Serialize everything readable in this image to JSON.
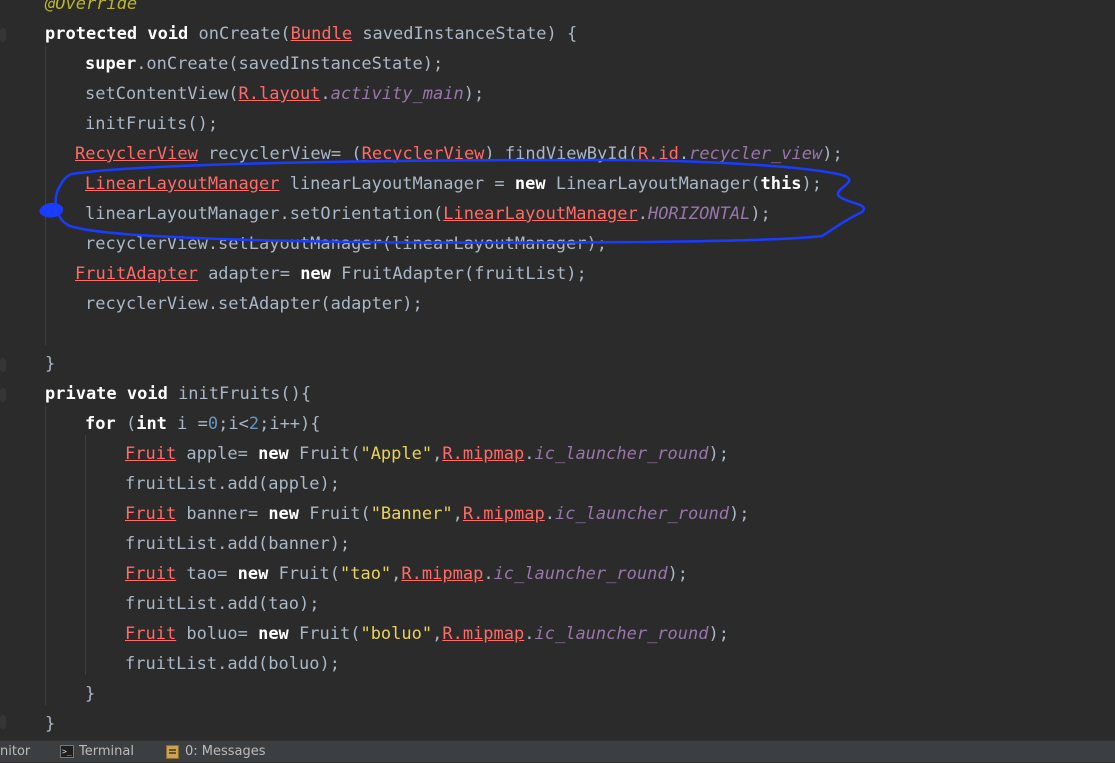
{
  "colors": {
    "background": "#2b2b2b",
    "default": "#a9b7c6",
    "keyword": "#ffffff",
    "annotation": "#bbb529",
    "error": "#ff6b68",
    "field": "#9876aa",
    "string": "#e8d35a",
    "number": "#6897bb",
    "annotation_ink": "#1a3cff"
  },
  "editor": {
    "lines": [
      [
        {
          "t": "@Override",
          "c": "annotation",
          "i": true
        }
      ],
      [
        {
          "t": "protected void ",
          "c": "keyword",
          "b": true
        },
        {
          "t": "onCreate("
        },
        {
          "t": "Bundle",
          "c": "error",
          "u": true
        },
        {
          "t": " savedInstanceState) {"
        }
      ],
      [
        {
          "t": "super",
          "c": "keyword",
          "b": true
        },
        {
          "t": ".onCreate(savedInstanceState);"
        }
      ],
      [
        {
          "t": "setContentView("
        },
        {
          "t": "R.layout",
          "c": "error",
          "u": true
        },
        {
          "t": "."
        },
        {
          "t": "activity_main",
          "c": "field",
          "i": true
        },
        {
          "t": ");"
        }
      ],
      [
        {
          "t": "initFruits();"
        }
      ],
      [
        {
          "t": "RecyclerView",
          "c": "error",
          "u": true
        },
        {
          "t": " recyclerView= ("
        },
        {
          "t": "RecyclerView",
          "c": "error",
          "u": true
        },
        {
          "t": ") findViewById("
        },
        {
          "t": "R.id",
          "c": "error",
          "u": true
        },
        {
          "t": "."
        },
        {
          "t": "recycler_view",
          "c": "field",
          "i": true
        },
        {
          "t": ");"
        }
      ],
      [
        {
          "t": "LinearLayoutManager",
          "c": "error",
          "u": true
        },
        {
          "t": " linearLayoutManager = "
        },
        {
          "t": "new ",
          "c": "keyword",
          "b": true
        },
        {
          "t": "LinearLayoutManager("
        },
        {
          "t": "this",
          "c": "keyword",
          "b": true
        },
        {
          "t": ");"
        }
      ],
      [
        {
          "t": "linearLayoutManager.setOrientation("
        },
        {
          "t": "LinearLayoutManager",
          "c": "error",
          "u": true
        },
        {
          "t": "."
        },
        {
          "t": "HORIZONTAL",
          "c": "field",
          "i": true
        },
        {
          "t": ");"
        }
      ],
      [
        {
          "t": "recyclerView.setLayoutManager(linearLayoutManager);"
        }
      ],
      [
        {
          "t": "FruitAdapter",
          "c": "error",
          "u": true
        },
        {
          "t": " adapter= "
        },
        {
          "t": "new ",
          "c": "keyword",
          "b": true
        },
        {
          "t": "FruitAdapter(fruitList);"
        }
      ],
      [
        {
          "t": "recyclerView.setAdapter(adapter);"
        }
      ],
      [],
      [
        {
          "t": "}"
        }
      ],
      [
        {
          "t": "private void ",
          "c": "keyword",
          "b": true
        },
        {
          "t": "initFruits(){"
        }
      ],
      [
        {
          "t": "for ",
          "c": "keyword",
          "b": true
        },
        {
          "t": "("
        },
        {
          "t": "int ",
          "c": "keyword",
          "b": true
        },
        {
          "t": "i ="
        },
        {
          "t": "0",
          "c": "number"
        },
        {
          "t": ";i<"
        },
        {
          "t": "2",
          "c": "number"
        },
        {
          "t": ";i++){"
        }
      ],
      [
        {
          "t": "Fruit",
          "c": "error",
          "u": true
        },
        {
          "t": " apple= "
        },
        {
          "t": "new ",
          "c": "keyword",
          "b": true
        },
        {
          "t": "Fruit("
        },
        {
          "t": "\"Apple\"",
          "c": "string"
        },
        {
          "t": ","
        },
        {
          "t": "R.mipmap",
          "c": "error",
          "u": true
        },
        {
          "t": "."
        },
        {
          "t": "ic_launcher_round",
          "c": "field",
          "i": true
        },
        {
          "t": ");"
        }
      ],
      [
        {
          "t": "fruitList.add(apple);"
        }
      ],
      [
        {
          "t": "Fruit",
          "c": "error",
          "u": true
        },
        {
          "t": " banner= "
        },
        {
          "t": "new ",
          "c": "keyword",
          "b": true
        },
        {
          "t": "Fruit("
        },
        {
          "t": "\"Banner\"",
          "c": "string"
        },
        {
          "t": ","
        },
        {
          "t": "R.mipmap",
          "c": "error",
          "u": true
        },
        {
          "t": "."
        },
        {
          "t": "ic_launcher_round",
          "c": "field",
          "i": true
        },
        {
          "t": ");"
        }
      ],
      [
        {
          "t": "fruitList.add(banner);"
        }
      ],
      [
        {
          "t": "Fruit",
          "c": "error",
          "u": true
        },
        {
          "t": " tao= "
        },
        {
          "t": "new ",
          "c": "keyword",
          "b": true
        },
        {
          "t": "Fruit("
        },
        {
          "t": "\"tao\"",
          "c": "string"
        },
        {
          "t": ","
        },
        {
          "t": "R.mipmap",
          "c": "error",
          "u": true
        },
        {
          "t": "."
        },
        {
          "t": "ic_launcher_round",
          "c": "field",
          "i": true
        },
        {
          "t": ");"
        }
      ],
      [
        {
          "t": "fruitList.add(tao);"
        }
      ],
      [
        {
          "t": "Fruit",
          "c": "error",
          "u": true
        },
        {
          "t": " boluo= "
        },
        {
          "t": "new ",
          "c": "keyword",
          "b": true
        },
        {
          "t": "Fruit("
        },
        {
          "t": "\"boluo\"",
          "c": "string"
        },
        {
          "t": ","
        },
        {
          "t": "R.mipmap",
          "c": "error",
          "u": true
        },
        {
          "t": "."
        },
        {
          "t": "ic_launcher_round",
          "c": "field",
          "i": true
        },
        {
          "t": ");"
        }
      ],
      [
        {
          "t": "fruitList.add(boluo);"
        }
      ],
      [
        {
          "t": "}"
        }
      ],
      [
        {
          "t": "}"
        }
      ]
    ]
  },
  "statusbar": {
    "monitor_label": "nitor",
    "terminal_label": "Terminal",
    "messages_label": "0: Messages",
    "terminal_icon": "terminal-icon",
    "messages_icon": "messages-icon"
  }
}
